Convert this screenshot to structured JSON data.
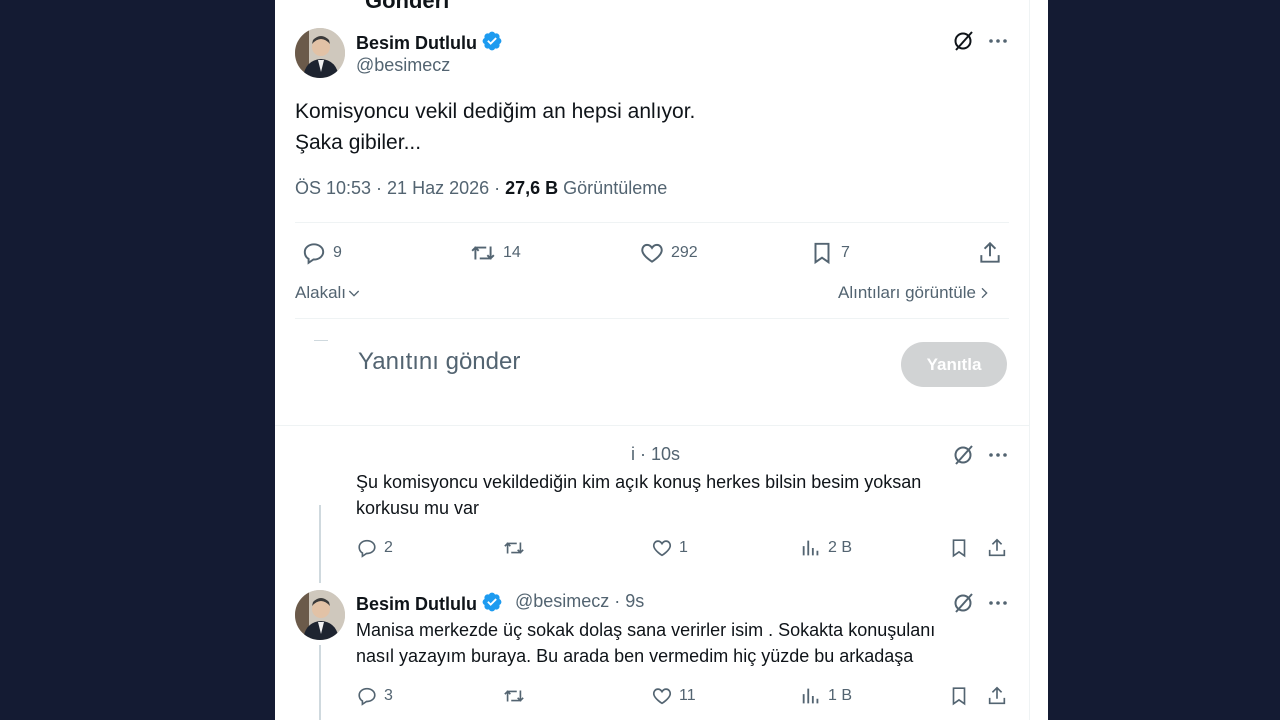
{
  "main_tweet": {
    "header_cut": "Gönderi",
    "author": "Besim Dutlulu",
    "handle": "@besimecz",
    "text_line1": "Komisyoncu vekil dediğim an hepsi anlıyor.",
    "text_line2": "Şaka gibiler...",
    "time": "ÖS 10:53 · 21 Haz 2026 · ",
    "views_count": "27,6 B",
    "views_label": " Görüntüleme",
    "replies": "9",
    "retweets": "14",
    "likes": "292",
    "bookmarks": "7"
  },
  "sort_label": "Alakalı",
  "quotes_label": "Alıntıları görüntüle",
  "composer": {
    "placeholder": "Yanıtını gönder",
    "button": "Yanıtla"
  },
  "reply1": {
    "time": "i · 10s",
    "text_line1": "Şu komisyoncu vekildediğin kim açık konuş herkes bilsin besim yoksan",
    "text_line2": "korkusu mu var",
    "replies": "2",
    "likes": "1",
    "views": "2 B"
  },
  "reply2": {
    "author": "Besim Dutlulu",
    "handle_time": "@besimecz · 9s",
    "text_line1": "Manisa merkezde üç sokak dolaş sana verirler isim . Sokakta konuşulanı",
    "text_line2": "nasıl yazayım buraya. Bu arada ben vermedim hiç yüzde bu arkadaşa",
    "replies": "3",
    "likes": "11",
    "views": "1 B"
  },
  "colors": {
    "background": "#141b33",
    "verified": "#1d9bf0",
    "secondary_text": "#536471",
    "disabled_button": "#d1d3d4"
  },
  "icons": [
    "verified-badge-icon",
    "grok-icon",
    "more-icon",
    "reply-icon",
    "retweet-icon",
    "like-icon",
    "bookmark-icon",
    "share-icon",
    "views-icon",
    "chevron-down-icon",
    "chevron-right-icon"
  ]
}
